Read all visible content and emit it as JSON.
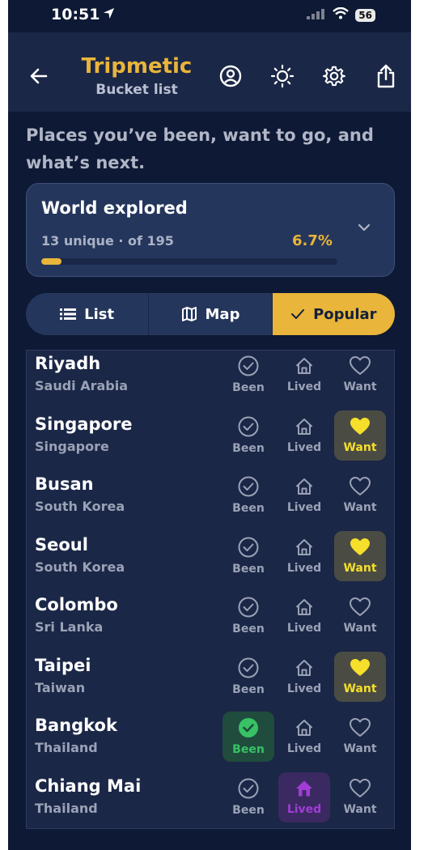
{
  "status_bar": {
    "time": "10:51",
    "battery": "56",
    "location_icon": "location-arrow-icon",
    "signal_icon": "signal-icon",
    "wifi_icon": "wifi-icon"
  },
  "header": {
    "app_name": "Tripmetic",
    "subtitle": "Bucket list",
    "back_icon": "arrow-left-icon",
    "profile_icon": "user-circle-icon",
    "theme_icon": "sun-icon",
    "settings_icon": "gear-icon",
    "share_icon": "share-icon"
  },
  "tagline": "Places you’ve been, want to go, and what’s next.",
  "explored": {
    "title": "World explored",
    "count_text": "13 unique · of 195",
    "percent_text": "6.7%",
    "progress": 0.067
  },
  "view_tabs": [
    {
      "label": "List",
      "icon": "list-icon",
      "active": false
    },
    {
      "label": "Map",
      "icon": "map-icon",
      "active": false
    },
    {
      "label": "Popular",
      "icon": "check-icon",
      "active": true
    }
  ],
  "action_labels": {
    "been": "Been",
    "lived": "Lived",
    "want": "Want"
  },
  "places": [
    {
      "city": "Riyadh",
      "country": "Saudi Arabia",
      "been": false,
      "lived": false,
      "want": false
    },
    {
      "city": "Singapore",
      "country": "Singapore",
      "been": false,
      "lived": false,
      "want": true
    },
    {
      "city": "Busan",
      "country": "South Korea",
      "been": false,
      "lived": false,
      "want": false
    },
    {
      "city": "Seoul",
      "country": "South Korea",
      "been": false,
      "lived": false,
      "want": true
    },
    {
      "city": "Colombo",
      "country": "Sri Lanka",
      "been": false,
      "lived": false,
      "want": false
    },
    {
      "city": "Taipei",
      "country": "Taiwan",
      "been": false,
      "lived": false,
      "want": true
    },
    {
      "city": "Bangkok",
      "country": "Thailand",
      "been": true,
      "lived": false,
      "want": false
    },
    {
      "city": "Chiang Mai",
      "country": "Thailand",
      "been": false,
      "lived": true,
      "want": false
    }
  ],
  "colors": {
    "accent": "#e9b53a",
    "want_active": "#f6df2b",
    "been_active": "#38c265",
    "lived_active": "#a13cd6",
    "inactive": "#9aa2b6"
  }
}
